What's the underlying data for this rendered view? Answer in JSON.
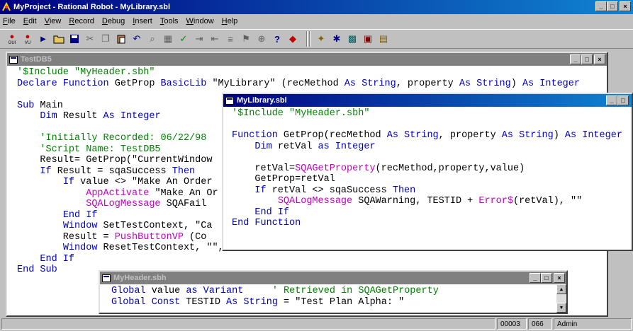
{
  "app": {
    "title": "MyProject - Rational Robot - MyLibrary.sbl",
    "controls": {
      "minimize": "_",
      "restore": "□",
      "close": "×"
    }
  },
  "menu": [
    "File",
    "Edit",
    "View",
    "Record",
    "Debug",
    "Insert",
    "Tools",
    "Window",
    "Help"
  ],
  "menu_accel": [
    "F",
    "E",
    "V",
    "R",
    "D",
    "I",
    "T",
    "W",
    "H"
  ],
  "toolbar": {
    "record_gui_caption": "GUI",
    "record_vu_caption": "VU",
    "icons": [
      "record-gui-icon",
      "record-vu-icon",
      "play-icon",
      "open-icon",
      "save-icon",
      "cut-icon",
      "copy-icon",
      "paste-icon",
      "undo-icon",
      "find-icon",
      "grid-icon",
      "compile-icon",
      "indent-icon",
      "outdent-icon",
      "comment-icon",
      "bookmark-icon",
      "inspector-icon",
      "help-icon",
      "verification-point-icon",
      "tool-a-icon",
      "tool-b-icon",
      "tool-c-icon",
      "tool-d-icon",
      "tool-e-icon"
    ]
  },
  "windows": {
    "testdb5": {
      "title": "TestDB5",
      "lines": [
        "'$Include \"MyHeader.sbh\"",
        "Declare Function GetProp BasicLib \"MyLibrary\" (recMethod As String, property As String) As Integer",
        "",
        "Sub Main",
        "    Dim Result As Integer",
        "",
        "    'Initially Recorded: 06/22/98",
        "    'Script Name: TestDB5",
        "    Result= GetProp(\"CurrentWindow",
        "    If Result = sqaSuccess Then",
        "        If value <> \"Make An Order",
        "            AppActivate \"Make An Or",
        "            SQALogMessage SQAFail",
        "        End If",
        "        Window SetTestContext, \"Ca",
        "        Result = PushButtonVP (Co",
        "        Window ResetTestContext, \"\", \"\"",
        "    End If",
        "End Sub"
      ]
    },
    "mylibrary": {
      "title": "MyLibrary.sbl",
      "lines": [
        "'$Include \"MyHeader.sbh\"",
        "",
        "Function GetProp(recMethod As String, property As String) As Integer",
        "    Dim retVal as Integer",
        "",
        "    retVal=SQAGetProperty(recMethod,property,value)",
        "    GetProp=retVal",
        "    If retVal <> sqaSuccess Then",
        "        SQALogMessage SQAWarning, TESTID + Error$(retVal), \"\"",
        "    End If",
        "End Function"
      ]
    },
    "myheader": {
      "title": "MyHeader.sbh",
      "lines": [
        "Global value as Variant     ' Retrieved in SQAGetProperty",
        "Global Const TESTID As String = \"Test Plan Alpha: \""
      ]
    }
  },
  "status": {
    "line": "00003",
    "column": "066",
    "user": "Admin"
  },
  "colors": {
    "keyword": "#0000c0",
    "function": "#c000c0",
    "comment": "#008000",
    "active_title": "#000080",
    "inactive_title": "#808080"
  }
}
